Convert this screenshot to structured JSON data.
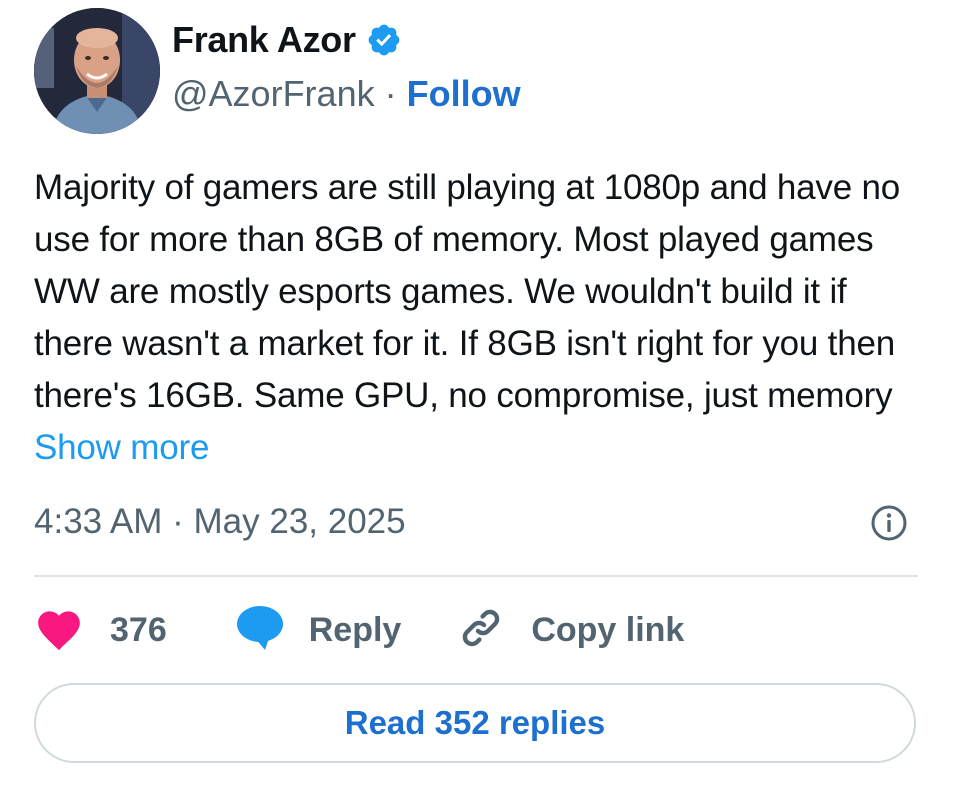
{
  "author": {
    "display_name": "Frank Azor",
    "handle": "@AzorFrank",
    "separator": "·",
    "follow_label": "Follow"
  },
  "tweet": {
    "text": "Majority of gamers are still playing at 1080p and have no use for more than 8GB of memory. Most played games WW are mostly esports games. We wouldn't build it if there wasn't a market for it. If 8GB isn't right for you then there's 16GB. Same GPU, no compromise, just memory",
    "show_more_label": "Show more",
    "timestamp": "4:33 AM · May 23, 2025"
  },
  "actions": {
    "likes_count": "376",
    "reply_label": "Reply",
    "copy_link_label": "Copy link"
  },
  "read_replies_label": "Read 352 replies",
  "icons": {
    "verified": "verified-badge-icon",
    "info": "info-icon",
    "like": "heart-icon",
    "reply": "speech-bubble-icon",
    "copy": "link-icon"
  },
  "colors": {
    "accent_blue": "#1d9bf0",
    "follow_blue": "#1d6fd0",
    "heart_pink": "#f91880",
    "secondary_text": "#536471"
  }
}
